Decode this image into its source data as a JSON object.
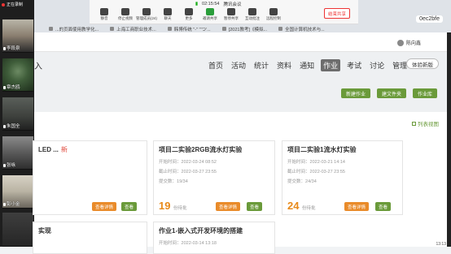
{
  "meeting": {
    "time": "02:15:54",
    "app_name": "腾讯会议",
    "recording": "正在录制",
    "tools": [
      "静音",
      "停止视频",
      "管理成员(24)",
      "聊天",
      "更多",
      "邀请共享",
      "暂停共享",
      "互动批注",
      "远程控制"
    ],
    "end_button": "结束共享"
  },
  "browser": {
    "url_tail": "0ec2bfe",
    "bookmarks": [
      "...的页面使用教学化...",
      "上海工商职业技术...",
      "韩博传统 \"-\" '\"つ'...",
      "[2021教考]《模拟...",
      "全国计算机技术与..."
    ]
  },
  "participants": [
    {
      "name": "李段泉"
    },
    {
      "name": "章杰鸥"
    },
    {
      "name": "朱国全"
    },
    {
      "name": "张咏"
    },
    {
      "name": "彭小金"
    }
  ],
  "page": {
    "partial_left": "入",
    "user_name": "陈向鑫",
    "nav": [
      "首页",
      "活动",
      "统计",
      "资料",
      "通知",
      "作业",
      "考试",
      "讨论",
      "管理"
    ],
    "active_nav": "作业",
    "experience_button": "体验新版",
    "actions": [
      "新建作业",
      "建文件夹",
      "作业库"
    ],
    "list_view": "列表视图",
    "cards": [
      {
        "title": "LED ...",
        "tag": "新",
        "start_label": "开始时间：",
        "start": "",
        "deadline_label": "截止时间：",
        "deadline": "",
        "submit_label": "提交数：",
        "submit": "",
        "count": "",
        "unit": "",
        "grade": "查看详情",
        "view": "查看"
      },
      {
        "title": "项目二实验2RGB流水灯实验",
        "start_label": "开始时间：",
        "start": "2022-03-24 08:52",
        "deadline_label": "截止时间：",
        "deadline": "2022-03-27 23:55",
        "submit_label": "提交数：",
        "submit": "19/34",
        "count": "19",
        "unit": "份待批",
        "grade": "查看详情",
        "view": "查看"
      },
      {
        "title": "项目二实验1流水灯实验",
        "start_label": "开始时间：",
        "start": "2022-03-21 14:14",
        "deadline_label": "截止时间：",
        "deadline": "2022-03-27 23:55",
        "submit_label": "提交数：",
        "submit": "24/34",
        "count": "24",
        "unit": "份待批",
        "grade": "查看详情",
        "view": "查看"
      },
      {
        "title": "实现",
        "start_label": "开始时间：",
        "start": "",
        "deadline_label": "",
        "deadline": "",
        "submit_label": "",
        "submit": "",
        "count": "",
        "unit": "",
        "grade": "",
        "view": ""
      },
      {
        "title": "作业1-嵌入式开发环境的搭建",
        "start_label": "开始时间：",
        "start": "2022-03-14 13:18",
        "deadline_label": "",
        "deadline": "",
        "submit_label": "",
        "submit": "",
        "count": "",
        "unit": "",
        "grade": "",
        "view": ""
      }
    ]
  },
  "taskbar": {
    "time": "13:13"
  }
}
